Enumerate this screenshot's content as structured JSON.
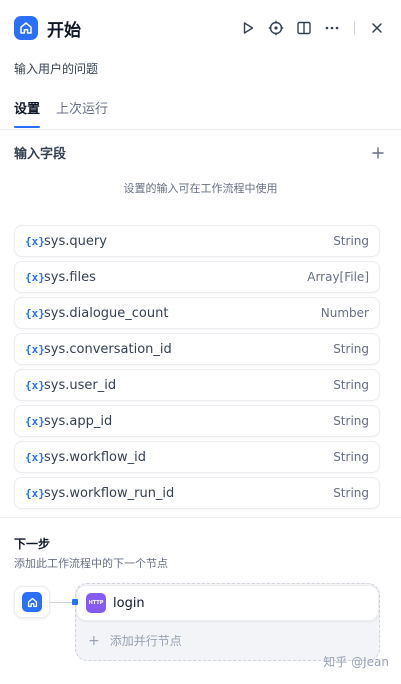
{
  "panel": {
    "title": "开始",
    "description": "输入用户的问题",
    "icon": "home-icon",
    "accent": "#2970ff"
  },
  "header_actions": [
    "run-icon",
    "locate-icon",
    "split-view-icon",
    "more-icon",
    "close-icon"
  ],
  "tabs": [
    {
      "label": "设置",
      "active": true
    },
    {
      "label": "上次运行",
      "active": false
    }
  ],
  "input_fields": {
    "title": "输入字段",
    "hint": "设置的输入可在工作流程中使用",
    "variables": [
      {
        "icon": "{x}",
        "name": "sys.query",
        "type": "String"
      },
      {
        "icon": "{x}",
        "name": "sys.files",
        "type": "Array[File]"
      },
      {
        "icon": "{x}",
        "name": "sys.dialogue_count",
        "type": "Number"
      },
      {
        "icon": "{x}",
        "name": "sys.conversation_id",
        "type": "String"
      },
      {
        "icon": "{x}",
        "name": "sys.user_id",
        "type": "String"
      },
      {
        "icon": "{x}",
        "name": "sys.app_id",
        "type": "String"
      },
      {
        "icon": "{x}",
        "name": "sys.workflow_id",
        "type": "String"
      },
      {
        "icon": "{x}",
        "name": "sys.workflow_run_id",
        "type": "String"
      }
    ]
  },
  "next_step": {
    "title": "下一步",
    "description": "添加此工作流程中的下一个节点",
    "next_node": {
      "badge": "HTTP",
      "label": "login",
      "color": "#875bf7"
    },
    "add_parallel_label": "添加并行节点"
  },
  "watermark": "知乎 @Jean"
}
